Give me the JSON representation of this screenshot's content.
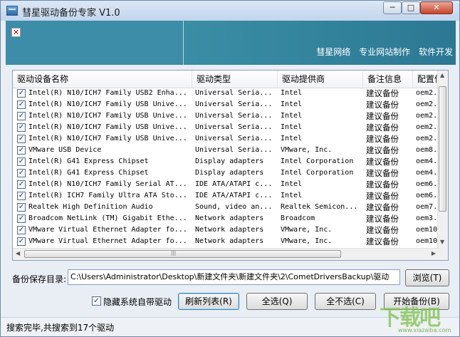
{
  "window": {
    "title": "彗星驱动备份专家 V1.0",
    "controls": {
      "minimize": "─",
      "maximize": "□",
      "close": "✕"
    }
  },
  "banner": {
    "broken_image_glyph": "✕",
    "links": [
      "彗星网络",
      "专业网站制作",
      "软件开发"
    ]
  },
  "table": {
    "headers": [
      "驱动设备名称",
      "驱动类型",
      "驱动提供商",
      "备注信息",
      "配置信"
    ],
    "rows": [
      {
        "checked": true,
        "name": "Intel(R) N10/ICH7 Family USB2 Enha...",
        "type": "Universal Seria...",
        "provider": "Intel",
        "note": "建议备份",
        "config": "oem2."
      },
      {
        "checked": true,
        "name": "Intel(R) N10/ICH7 Family USB Unive...",
        "type": "Universal Seria...",
        "provider": "Intel",
        "note": "建议备份",
        "config": "oem2."
      },
      {
        "checked": true,
        "name": "Intel(R) N10/ICH7 Family USB Unive...",
        "type": "Universal Seria...",
        "provider": "Intel",
        "note": "建议备份",
        "config": "oem2."
      },
      {
        "checked": true,
        "name": "Intel(R) N10/ICH7 Family USB Unive...",
        "type": "Universal Seria...",
        "provider": "Intel",
        "note": "建议备份",
        "config": "oem2."
      },
      {
        "checked": true,
        "name": "Intel(R) N10/ICH7 Family USB Unive...",
        "type": "Universal Seria...",
        "provider": "Intel",
        "note": "建议备份",
        "config": "oem2."
      },
      {
        "checked": true,
        "name": "VMware USB Device",
        "type": "Universal Seria...",
        "provider": "VMware, Inc.",
        "note": "建议备份",
        "config": "oem8."
      },
      {
        "checked": true,
        "name": "Intel(R) G41 Express Chipset",
        "type": "Display adapters",
        "provider": "Intel Corporation",
        "note": "建议备份",
        "config": "oem4."
      },
      {
        "checked": true,
        "name": "Intel(R) G41 Express Chipset",
        "type": "Display adapters",
        "provider": "Intel Corporation",
        "note": "建议备份",
        "config": "oem4."
      },
      {
        "checked": true,
        "name": "Intel(R) N10/ICH7 Family Serial AT...",
        "type": "IDE ATA/ATAPI c...",
        "provider": "Intel",
        "note": "建议备份",
        "config": "oem6."
      },
      {
        "checked": true,
        "name": "Intel(R) ICH7 Family Ultra ATA Sto...",
        "type": "IDE ATA/ATAPI c...",
        "provider": "Intel",
        "note": "建议备份",
        "config": "oem6."
      },
      {
        "checked": true,
        "name": "Realtek High Definition Audio",
        "type": "Sound, video an...",
        "provider": "Realtek Semicon...",
        "note": "建议备份",
        "config": "oem7."
      },
      {
        "checked": true,
        "name": "Broadcom NetLink (TM) Gigabit Ethe...",
        "type": "Network adapters",
        "provider": "Broadcom",
        "note": "建议备份",
        "config": "oem3."
      },
      {
        "checked": true,
        "name": "VMware Virtual Ethernet Adapter fo...",
        "type": "Network adapters",
        "provider": "VMware, Inc.",
        "note": "建议备份",
        "config": "oem10"
      },
      {
        "checked": true,
        "name": "VMware Virtual Ethernet Adapter fo...",
        "type": "Network adapters",
        "provider": "VMware, Inc.",
        "note": "建议备份",
        "config": "oem10"
      }
    ]
  },
  "save": {
    "label": "备份保存目录:",
    "path": "C:\\Users\\Administrator\\Desktop\\新建文件夹\\新建文件夹\\2\\CometDriversBackup\\驱动",
    "browse_label": "浏览(T)"
  },
  "options": {
    "hide_system_checked": true,
    "hide_system_label": "隐藏系统自带驱动",
    "refresh_label": "刷新列表(R)",
    "select_all_label": "全选(Q)",
    "select_none_label": "全不选(C)",
    "start_backup_label": "开始备份(B)"
  },
  "status": {
    "text": "搜索完毕,共搜索到17个驱动"
  },
  "watermark": {
    "logo": "下载吧",
    "url": "www.xiazaiba.com"
  },
  "glyphs": {
    "check": "✓",
    "up": "▲",
    "down": "▼",
    "left": "◀",
    "right": "▶",
    "grip": "|||"
  }
}
